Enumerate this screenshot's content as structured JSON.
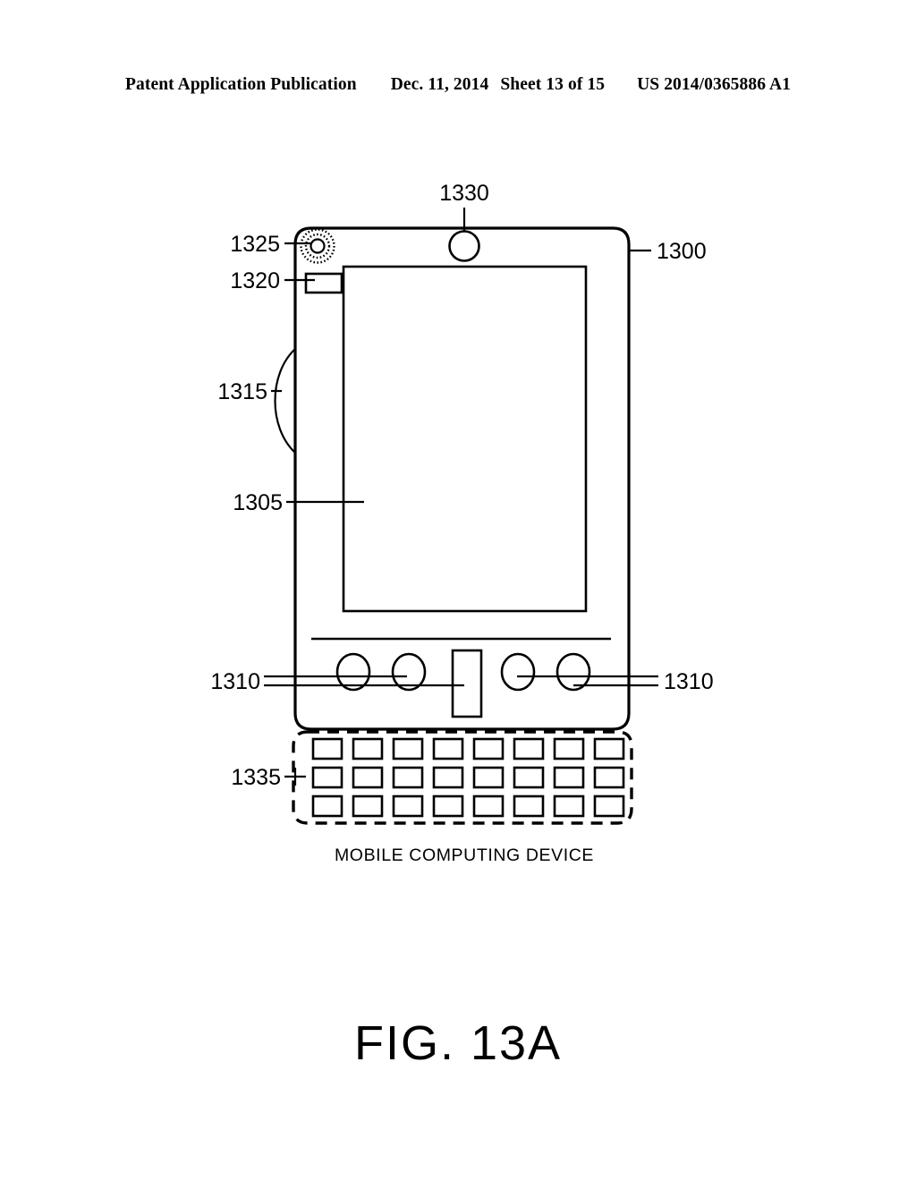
{
  "header": {
    "publication": "Patent Application Publication",
    "date": "Dec. 11, 2014",
    "sheet": "Sheet 13 of 15",
    "number": "US 2014/0365886 A1"
  },
  "figure": {
    "caption": "FIG. 13A",
    "device_caption": "MOBILE COMPUTING DEVICE",
    "reference_numerals": {
      "device_body": "1300",
      "display_screen": "1305",
      "buttons_left": "1310",
      "buttons_right": "1310",
      "side_element": "1315",
      "indicator": "1320",
      "speaker": "1325",
      "camera": "1330",
      "keyboard": "1335"
    }
  },
  "chart_data": {
    "type": "diagram",
    "title": "FIG. 13A - MOBILE COMPUTING DEVICE",
    "keyboard": {
      "rows": 3,
      "columns": 8,
      "total_keys": 24
    },
    "round_buttons": 4,
    "rect_buttons": 1
  },
  "colors": {
    "ink": "#000000",
    "page": "#ffffff"
  }
}
